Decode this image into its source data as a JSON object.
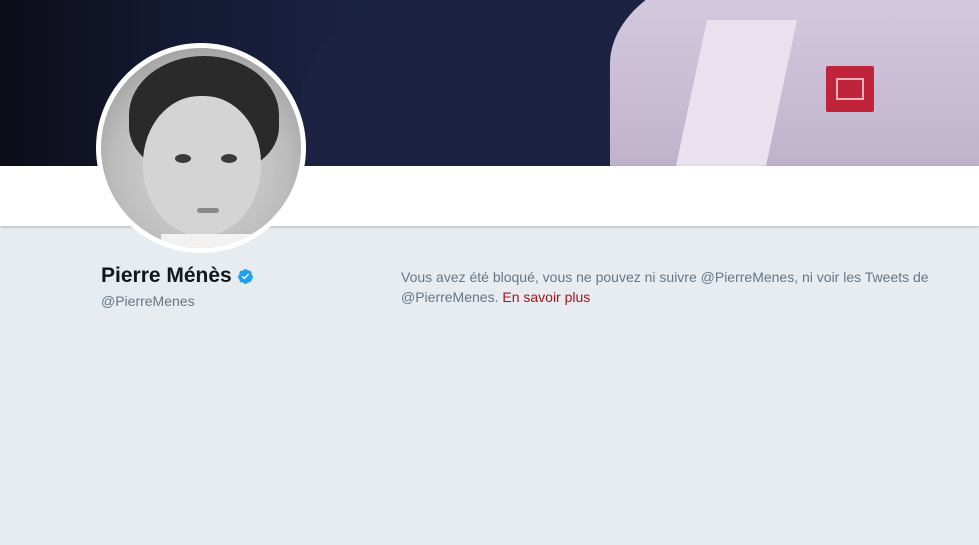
{
  "profile": {
    "display_name": "Pierre Ménès",
    "handle": "@PierreMenes",
    "verified_icon": "verified-badge-icon",
    "avatar_icon": "profile-photo",
    "banner_icon": "header-photo"
  },
  "blocked_notice": {
    "message": "Vous avez été bloqué, vous ne pouvez ni suivre @PierreMenes, ni voir les Tweets de @PierreMenes.",
    "learn_more": "En savoir plus"
  },
  "colors": {
    "background": "#e6ecf0",
    "text_primary": "#14171a",
    "text_secondary": "#657786",
    "link": "#a5141e",
    "verified": "#1da1f2"
  }
}
